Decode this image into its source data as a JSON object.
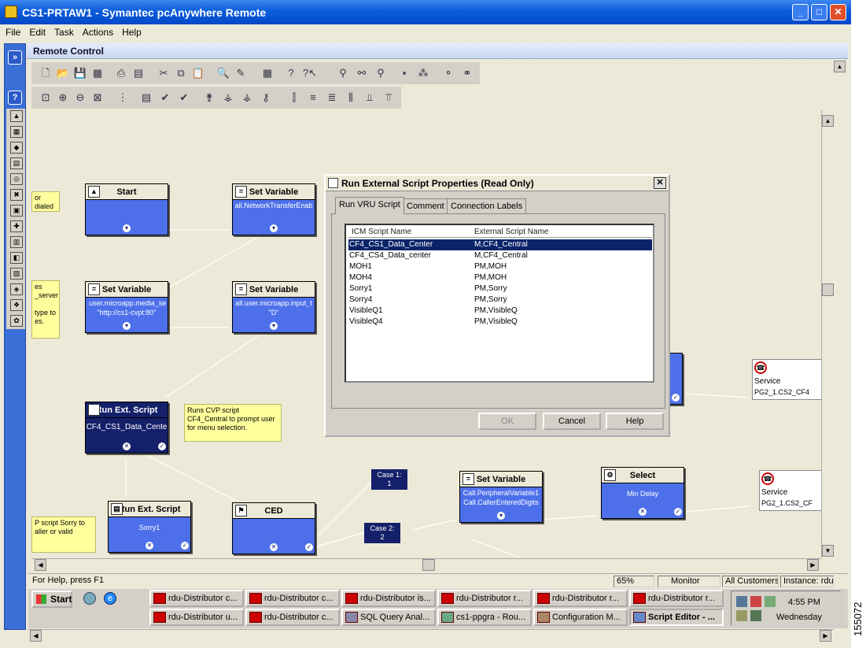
{
  "window": {
    "title": "CS1-PRTAW1 - Symantec pcAnywhere Remote"
  },
  "menu": [
    "File",
    "Edit",
    "Task",
    "Actions",
    "Help"
  ],
  "panel": {
    "title": "Remote Control"
  },
  "nodes": {
    "start": {
      "title": "Start"
    },
    "setvar1": {
      "title": "Set Variable",
      "body": "all.NetworkTransferEnab"
    },
    "setvar2": {
      "title": "Set Variable",
      "body": ".user.microapp.media_se",
      "body2": "\"http://cs1-cvpt:80\""
    },
    "setvar3": {
      "title": "Set Variable",
      "body": "all.user.microapp.input_t",
      "body2": "\"D\""
    },
    "runext1": {
      "title": "Run Ext. Script",
      "body": "CF4_CS1_Data_Cente"
    },
    "runext2": {
      "title": "Run Ext. Script",
      "body": "Sorry1"
    },
    "ced": {
      "title": "CED"
    },
    "setvar4": {
      "title": "Set Variable",
      "body": "Call.PeripheralVariable1",
      "body2": "Call.CallerEnteredDigits"
    },
    "select": {
      "title": "Select",
      "body": "Min Delay"
    },
    "service1": {
      "title": "Service",
      "body": "PG2_1.CS2_CF4"
    },
    "service2": {
      "title": "Service",
      "body": "PG2_1.CS2_CF"
    }
  },
  "notes": {
    "note_dialed": "or dialed",
    "note_server": "es\n_server\n\ntype to\nes.",
    "note_runs": "Runs CVP script\nCF4_Central to prompt user\nfor menu selection.",
    "note_sorry": "P script Sorry to\naller or valid"
  },
  "cases": {
    "case1": "Case 1:\n1",
    "case2": "Case 2:\n2"
  },
  "dialog": {
    "title": "Run External Script Properties (Read Only)",
    "tabs": [
      "Run VRU Script",
      "Comment",
      "Connection Labels"
    ],
    "columns": [
      "ICM Script Name",
      "External Script Name"
    ],
    "rows": [
      [
        "CF4_CS1_Data_Center",
        "M,CF4_Central"
      ],
      [
        "CF4_CS4_Data_center",
        "M,CF4_Central"
      ],
      [
        "MOH1",
        "PM,MOH"
      ],
      [
        "MOH4",
        "PM,MOH"
      ],
      [
        "Sorry1",
        "PM,Sorry"
      ],
      [
        "Sorry4",
        "PM,Sorry"
      ],
      [
        "VisibleQ1",
        "PM,VisibleQ"
      ],
      [
        "VisibleQ4",
        "PM,VisibleQ"
      ]
    ],
    "ok": "OK",
    "cancel": "Cancel",
    "help": "Help"
  },
  "status": {
    "help": "For Help, press F1",
    "zoom": "65%",
    "monitor": "Monitor",
    "customers": "All Customers",
    "instance": "Instance: rdu"
  },
  "taskbar": {
    "start": "Start",
    "tasks": [
      "rdu-Distributor c...",
      "rdu-Distributor c...",
      "rdu-Distributor is...",
      "rdu-Distributor r...",
      "rdu-Distributor r...",
      "rdu-Distributor r...",
      "rdu-Distributor u...",
      "rdu-Distributor c...",
      "SQL Query Anal...",
      "cs1-ppgra - Rou...",
      "Configuration M...",
      "Script Editor - ..."
    ],
    "time": "4:55 PM",
    "day": "Wednesday"
  },
  "side_number": "155072"
}
